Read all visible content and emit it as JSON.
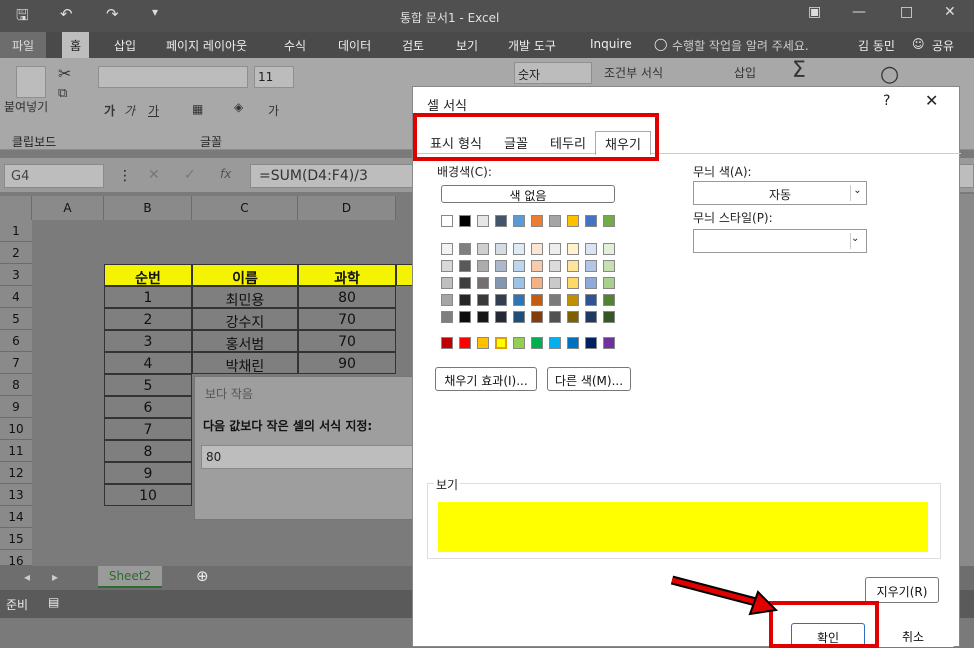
{
  "titlebar": {
    "title": "통합 문서1 - Excel"
  },
  "ribbon_tabs": [
    {
      "label": "파일"
    },
    {
      "label": "홈"
    },
    {
      "label": "삽입"
    },
    {
      "label": "페이지 레이아웃"
    },
    {
      "label": "수식"
    },
    {
      "label": "데이터"
    },
    {
      "label": "검토"
    },
    {
      "label": "보기"
    },
    {
      "label": "개발 도구"
    },
    {
      "label": "Inquire"
    }
  ],
  "tell_me": "수행할 작업을 알려 주세요.",
  "user": "김 동민",
  "share": "공유",
  "ribbon": {
    "paste": "붙여넣기",
    "clipboard": "클립보드",
    "font_group": "글꼴",
    "font_size": "11",
    "number_format": "숫자",
    "conditional": "조건부 서식",
    "insert": "삽입"
  },
  "formula_bar": {
    "name_box": "G4",
    "fx": "fx",
    "formula": "=SUM(D4:F4)/3"
  },
  "columns": [
    "A",
    "B",
    "C",
    "D"
  ],
  "rows": [
    "1",
    "2",
    "3",
    "4",
    "5",
    "6",
    "7",
    "8",
    "9",
    "10",
    "11",
    "12",
    "13",
    "14",
    "15",
    "16"
  ],
  "table": {
    "headers": [
      "순번",
      "이름",
      "과학"
    ],
    "rows": [
      {
        "no": "1",
        "name": "최민용",
        "score": "80"
      },
      {
        "no": "2",
        "name": "강수지",
        "score": "70"
      },
      {
        "no": "3",
        "name": "홍서범",
        "score": "70"
      },
      {
        "no": "4",
        "name": "박채린",
        "score": "90"
      },
      {
        "no": "5"
      },
      {
        "no": "6"
      },
      {
        "no": "7"
      },
      {
        "no": "8"
      },
      {
        "no": "9"
      },
      {
        "no": "10"
      }
    ]
  },
  "sheet_tab": "Sheet2",
  "status": "준비",
  "less_than_dialog": {
    "title": "보다 작음",
    "prompt": "다음 값보다 작은 셀의 서식 지정:",
    "value": "80"
  },
  "format_dialog": {
    "title": "셀 서식",
    "help": "?",
    "tabs": [
      "표시 형식",
      "글꼴",
      "테두리",
      "채우기"
    ],
    "bg_color_label": "배경색(C):",
    "no_color": "색 없음",
    "fill_effects": "채우기 효과(I)...",
    "more_colors": "다른 색(M)...",
    "pattern_color_label": "무늬 색(A):",
    "pattern_color_value": "자동",
    "pattern_style_label": "무늬 스타일(P):",
    "preview_label": "보기",
    "preview_color": "#ffff00",
    "clear": "지우기(R)",
    "ok": "확인",
    "cancel": "취소"
  }
}
